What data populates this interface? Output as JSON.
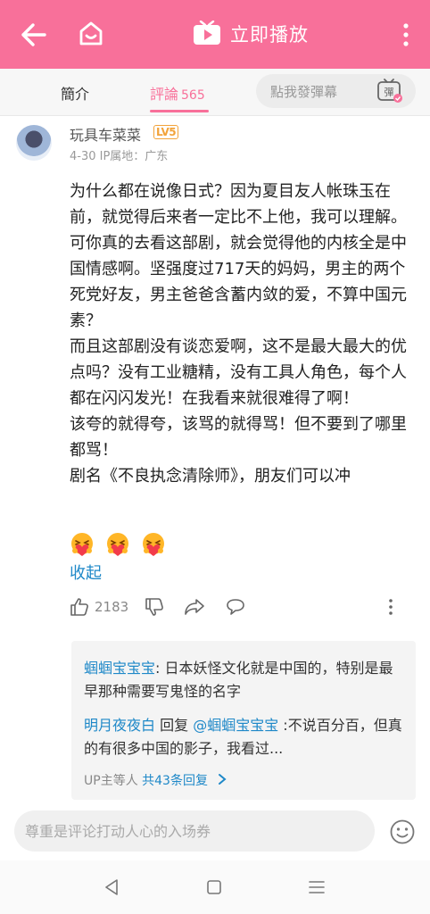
{
  "header": {
    "play_label": "立即播放",
    "icons": [
      "back-arrow-icon",
      "home-icon",
      "tv-play-icon",
      "more-vertical-icon"
    ]
  },
  "tabs": {
    "intro": "簡介",
    "comments": "評論",
    "comments_count": "565",
    "danmaku_placeholder": "點我發彈幕",
    "danmaku_icon_text": "彈"
  },
  "comment": {
    "username": "玩具车菜菜",
    "level": "LV5",
    "meta": "4-30  IP属地：广东",
    "lines": [
      "为什么都在说像日式？因为夏目友人帐珠玉在前，就觉得后来者一定比不上他，我可以理解。可你真的去看这部剧，就会觉得他的内核全是中国情感啊。坚强度过717天的妈妈，男主的两个死党好友，男主爸爸含蓄内敛的爱，不算中国元素？",
      "而且这部剧没有谈恋爱啊，这不是最大最大的优点吗？没有工业糖精，没有工具人角色，每个人都在闪闪发光！在我看来就很难得了啊！",
      "该夸的就得夸，该骂的就得骂！但不要到了哪里都骂！",
      "剧名《不良执念清除师》，朋友们可以冲"
    ],
    "emoji_name": "heart-hug-emoji",
    "collapse_label": "收起",
    "like_count": "2183"
  },
  "replies": {
    "reply1_user": "蝈蝈宝宝宝",
    "reply1_text": ": 日本妖怪文化就是中国的，特别是最早那种需要写鬼怪的名字",
    "reply2_user": "明月夜夜白",
    "reply2_mid": " 回复 ",
    "reply2_target": "@蝈蝈宝宝宝",
    "reply2_text": " :不说百分百，但真的有很多中国的影子，我看过...",
    "more_prefix": "UP主等人 ",
    "more_count": "共43条回复"
  },
  "input": {
    "placeholder": "尊重是评论打动人心的入场券"
  },
  "colors": {
    "brand_pink": "#f8709a",
    "link_blue": "#1e88c8"
  }
}
